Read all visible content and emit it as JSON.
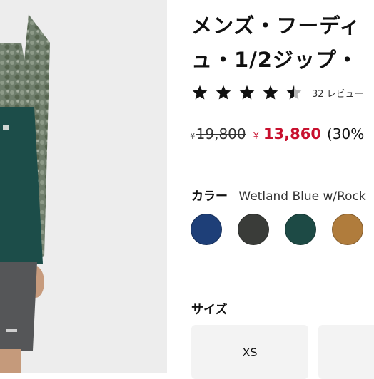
{
  "product": {
    "title_line1": "メンズ・フーディ",
    "title_line2": "ュ・1/2ジップ・",
    "rating": 4.5,
    "review_text": "32 レビュー",
    "currency_symbol": "¥",
    "original_price": "19,800",
    "sale_price": "13,860",
    "discount": "(30%"
  },
  "color": {
    "label": "カラー",
    "selected": "Wetland Blue w/Rock",
    "swatches": [
      {
        "name": "navy",
        "hex": "#1e3f78"
      },
      {
        "name": "charcoal",
        "hex": "#3a3c39"
      },
      {
        "name": "dark-green",
        "hex": "#1d4a45"
      },
      {
        "name": "tan",
        "hex": "#b07c3c"
      }
    ]
  },
  "size": {
    "label": "サイズ",
    "options": [
      "XS",
      ""
    ]
  }
}
